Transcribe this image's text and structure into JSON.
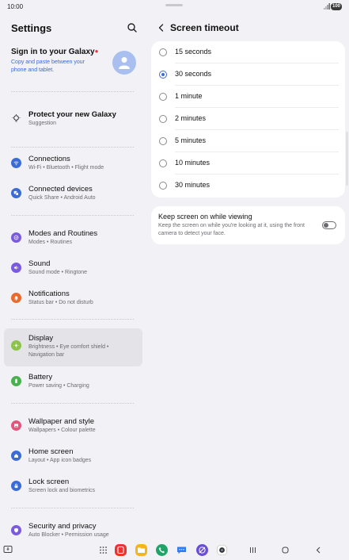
{
  "status_bar": {
    "time": "10:00",
    "battery": "100"
  },
  "settings_pane": {
    "title": "Settings",
    "account": {
      "title": "Sign in to your Galaxy",
      "subtitle": "Copy and paste between your phone and tablet."
    },
    "suggestion": {
      "title": "Protect your new Galaxy",
      "subtitle": "Suggestion"
    },
    "items": [
      {
        "label": "Connections",
        "subtitle": "Wi-Fi  •  Bluetooth  •  Flight mode",
        "color": "#3b6bd4",
        "icon": "wifi-icon"
      },
      {
        "label": "Connected devices",
        "subtitle": "Quick Share  •  Android Auto",
        "color": "#3b6bd4",
        "icon": "devices-icon"
      },
      {
        "label": "Modes and Routines",
        "subtitle": "Modes  •  Routines",
        "color": "#7a5ae0",
        "icon": "routines-icon"
      },
      {
        "label": "Sound",
        "subtitle": "Sound mode  •  Ringtone",
        "color": "#7a5ae0",
        "icon": "sound-icon"
      },
      {
        "label": "Notifications",
        "subtitle": "Status bar  •  Do not disturb",
        "color": "#e86a2c",
        "icon": "notification-icon"
      },
      {
        "label": "Display",
        "subtitle": "Brightness  •  Eye comfort shield  •  Navigation bar",
        "color": "#8bc34a",
        "icon": "display-icon"
      },
      {
        "label": "Battery",
        "subtitle": "Power saving  •  Charging",
        "color": "#4caf50",
        "icon": "battery-icon"
      },
      {
        "label": "Wallpaper and style",
        "subtitle": "Wallpapers  •  Colour palette",
        "color": "#e0567e",
        "icon": "wallpaper-icon"
      },
      {
        "label": "Home screen",
        "subtitle": "Layout  •  App icon badges",
        "color": "#3b6bd4",
        "icon": "home-icon"
      },
      {
        "label": "Lock screen",
        "subtitle": "Screen lock and biometrics",
        "color": "#3b6bd4",
        "icon": "lock-icon"
      },
      {
        "label": "Security and privacy",
        "subtitle": "Auto Blocker  •  Permission usage",
        "color": "#7a5ae0",
        "icon": "shield-icon"
      }
    ]
  },
  "detail_pane": {
    "title": "Screen timeout",
    "options": [
      {
        "label": "15 seconds",
        "selected": false
      },
      {
        "label": "30 seconds",
        "selected": true
      },
      {
        "label": "1 minute",
        "selected": false
      },
      {
        "label": "2 minutes",
        "selected": false
      },
      {
        "label": "5 minutes",
        "selected": false
      },
      {
        "label": "10 minutes",
        "selected": false
      },
      {
        "label": "30 minutes",
        "selected": false
      }
    ],
    "keep_on": {
      "title": "Keep screen on while viewing",
      "subtitle": "Keep the screen on while you're looking at it, using the front camera to detect your face.",
      "enabled": false
    }
  },
  "colors": {
    "accent": "#3b6bd4",
    "background": "#f2f2f6"
  }
}
